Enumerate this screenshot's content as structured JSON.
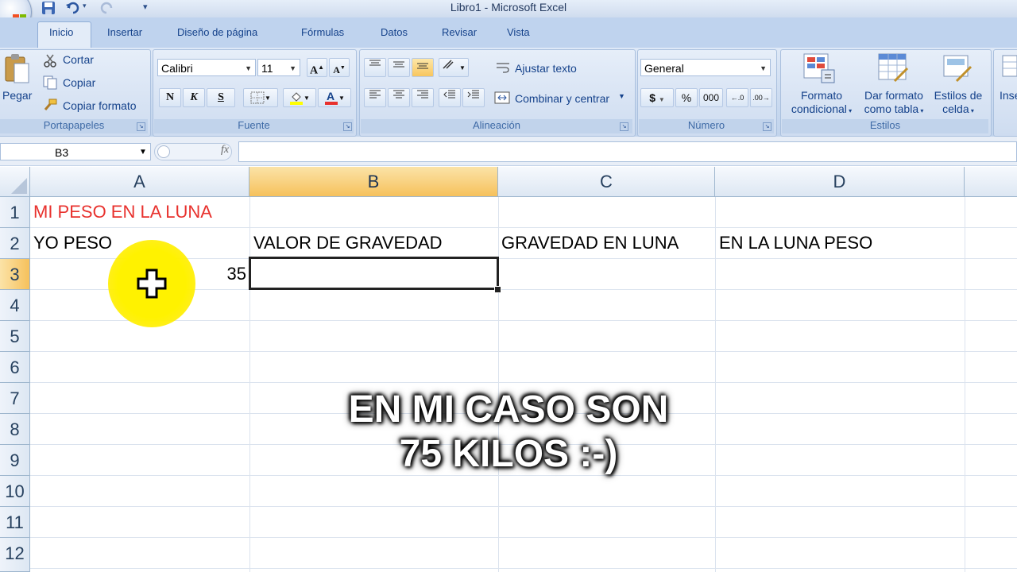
{
  "window": {
    "title": "Libro1 - Microsoft Excel"
  },
  "tabs": [
    "Inicio",
    "Insertar",
    "Diseño de página",
    "Fórmulas",
    "Datos",
    "Revisar",
    "Vista"
  ],
  "clipboard": {
    "paste": "Pegar",
    "cut": "Cortar",
    "copy": "Copiar",
    "format_painter": "Copiar formato",
    "label": "Portapapeles"
  },
  "font": {
    "name": "Calibri",
    "size": "11",
    "label": "Fuente",
    "bold": "N",
    "italic": "K",
    "underline": "S",
    "grow": "A",
    "shrink": "A"
  },
  "alignment": {
    "wrap": "Ajustar texto",
    "merge": "Combinar y centrar",
    "label": "Alineación"
  },
  "number": {
    "format": "General",
    "currency": "$",
    "percent": "%",
    "thousands": "000",
    "label": "Número"
  },
  "styles": {
    "cond1": "Formato",
    "cond2": "condicional",
    "table1": "Dar formato",
    "table2": "como tabla",
    "cell1": "Estilos de",
    "cell2": "celda",
    "label": "Estilos"
  },
  "partial": {
    "insert": "Inse"
  },
  "formula_bar": {
    "name_box": "B3",
    "fx": "fx"
  },
  "columns": [
    "A",
    "B",
    "C",
    "D"
  ],
  "rows": [
    "1",
    "2",
    "3",
    "4",
    "5",
    "6",
    "7",
    "8",
    "9",
    "10",
    "11",
    "12"
  ],
  "cells": {
    "A1": "MI PESO EN LA LUNA",
    "A2": "YO PESO",
    "B2": "VALOR DE GRAVEDAD",
    "C2": "GRAVEDAD EN LUNA",
    "D2": "EN LA LUNA PESO",
    "A3": "35"
  },
  "caption": {
    "line1": "EN MI CASO SON",
    "line2": "75 KILOS :-)"
  },
  "colors": {
    "title_red": "#e8312d",
    "selected_header": "#f6c15c",
    "cursor_highlight": "#ffe800"
  }
}
